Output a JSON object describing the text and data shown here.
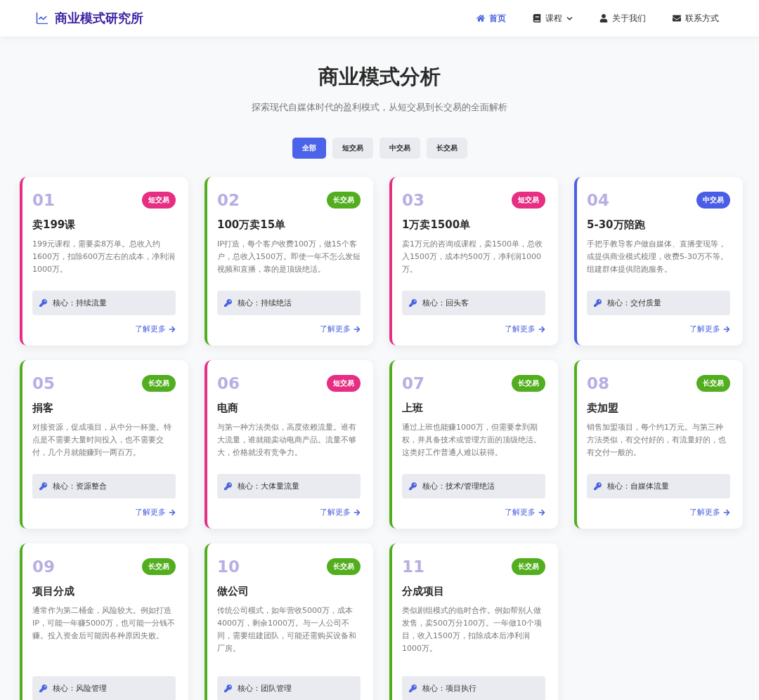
{
  "header": {
    "logo": "商业模式研究所",
    "nav": [
      {
        "label": "首页",
        "selected": true,
        "has_menu": false
      },
      {
        "label": "课程",
        "selected": false,
        "has_menu": true
      },
      {
        "label": "关于我们",
        "selected": false,
        "has_menu": false
      },
      {
        "label": "联系方式",
        "selected": false,
        "has_menu": false
      }
    ]
  },
  "hero": {
    "title": "商业模式分析",
    "subtitle": "探索现代自媒体时代的盈利模式，从短交易到长交易的全面解析"
  },
  "filters": [
    {
      "label": "全部",
      "selected": true
    },
    {
      "label": "短交易",
      "selected": false
    },
    {
      "label": "中交易",
      "selected": false
    },
    {
      "label": "长交易",
      "selected": false
    }
  ],
  "cards": [
    {
      "number": "01",
      "tag": "短交易",
      "color": "#e62e83",
      "title": "卖199课",
      "description": "199元课程，需要卖8万单。总收入约1600万，扣除600万左右的成本，净利润1000万。",
      "core": "核心：持续流量",
      "link": "了解更多"
    },
    {
      "number": "02",
      "tag": "长交易",
      "color": "#52ae1f",
      "title": "100万卖15单",
      "description": "IP打造，每个客户收费100万，做15个客户，总收入1500万。即使一年不怎么发短视频和直播，靠的是顶级绝活。",
      "core": "核心：持续绝活",
      "link": "了解更多"
    },
    {
      "number": "03",
      "tag": "短交易",
      "color": "#e62e83",
      "title": "1万卖1500单",
      "description": "卖1万元的咨询或课程，卖1500单，总收入1500万，成本约500万，净利润1000万。",
      "core": "核心：回头客",
      "link": "了解更多"
    },
    {
      "number": "04",
      "tag": "中交易",
      "color": "#4a5de6",
      "title": "5-30万陪跑",
      "description": "手把手教导客户做自媒体、直播变现等，或提供商业模式梳理，收费5-30万不等。组建群体提供陪跑服务。",
      "core": "核心：交付质量",
      "link": "了解更多"
    },
    {
      "number": "05",
      "tag": "长交易",
      "color": "#52ae1f",
      "title": "捐客",
      "description": "对接资源，促成项目，从中分一杯羹。特点是不需要大量时间投入，也不需要交付，几个月就能赚到一两百万。",
      "core": "核心：资源整合",
      "link": "了解更多"
    },
    {
      "number": "06",
      "tag": "短交易",
      "color": "#e62e83",
      "title": "电商",
      "description": "与第一种方法类似，高度依赖流量。谁有大流量，谁就能卖动电商产品。流量不够大，价格就没有竞争力。",
      "core": "核心：大体量流量",
      "link": "了解更多"
    },
    {
      "number": "07",
      "tag": "长交易",
      "color": "#52ae1f",
      "title": "上班",
      "description": "通过上班也能赚1000万，但需要拿到期权，并具备技术或管理方面的顶级绝活。这类好工作普通人难以获得。",
      "core": "核心：技术/管理绝活",
      "link": "了解更多"
    },
    {
      "number": "08",
      "tag": "长交易",
      "color": "#52ae1f",
      "title": "卖加盟",
      "description": "销售加盟项目，每个约1万元。与第三种方法类似，有交付好的，有流量好的，也有交付一般的。",
      "core": "核心：自媒体流量",
      "link": "了解更多"
    },
    {
      "number": "09",
      "tag": "长交易",
      "color": "#52ae1f",
      "title": "项目分成",
      "description": "通常作为第二桶金，风险较大。例如打造IP，可能一年赚5000万，也可能一分钱不赚。投入资金后可能因各种原因失败。",
      "core": "核心：风险管理"
    },
    {
      "number": "10",
      "tag": "长交易",
      "color": "#52ae1f",
      "title": "做公司",
      "description": "传统公司模式，如年营收5000万，成本4000万，剩余1000万。与一人公司不同，需要组建团队，可能还需购买设备和厂房。",
      "core": "核心：团队管理"
    },
    {
      "number": "11",
      "tag": "长交易",
      "color": "#52ae1f",
      "title": "分成项目",
      "description": "类似剧组模式的临时合作。例如帮别人做发售，卖500万分100万。一年做10个项目，收入1500万，扣除成本后净利润1000万。",
      "core": "核心：项目执行"
    }
  ]
}
